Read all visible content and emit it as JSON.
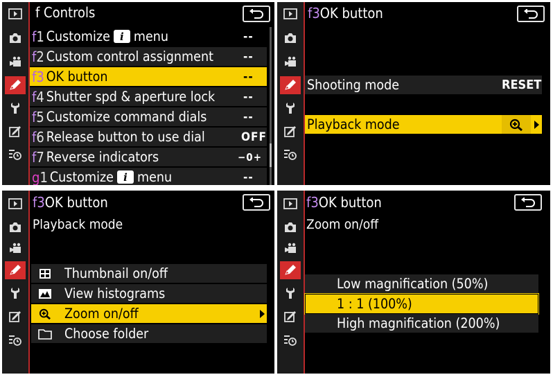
{
  "sidebar_icons": [
    "playback-icon",
    "camera-icon",
    "movie-icon",
    "pencil-icon",
    "wrench-icon",
    "retouch-icon",
    "recent-settings-icon"
  ],
  "panel1": {
    "title": "f Controls",
    "items": [
      {
        "code_letter": "f",
        "code_num": "1",
        "label_pre": "Customize",
        "badge": "i",
        "label_post": "menu",
        "value": "--"
      },
      {
        "code_letter": "f",
        "code_num": "2",
        "label": "Custom control assignment",
        "value": "--"
      },
      {
        "code_letter": "f",
        "code_num": "3",
        "label": "OK button",
        "value": "--"
      },
      {
        "code_letter": "f",
        "code_num": "4",
        "label": "Shutter spd & aperture lock",
        "value": "--"
      },
      {
        "code_letter": "f",
        "code_num": "5",
        "label": "Customize command dials",
        "value": "--"
      },
      {
        "code_letter": "f",
        "code_num": "6",
        "label": "Release button to use dial",
        "value": "OFF"
      },
      {
        "code_letter": "f",
        "code_num": "7",
        "label": "Reverse indicators",
        "value": "−0+"
      },
      {
        "code_letter": "g",
        "code_num": "1",
        "label_pre": "Customize",
        "badge": "i",
        "label_post": "menu",
        "value": "--"
      }
    ]
  },
  "panel2": {
    "code_letter": "f",
    "code_num": "3",
    "title": "OK button",
    "rows": [
      {
        "label": "Shooting mode",
        "value": "RESET"
      },
      {
        "label": "Playback mode",
        "icon": "zoom-icon"
      }
    ]
  },
  "panel3": {
    "code_letter": "f",
    "code_num": "3",
    "title": "OK button",
    "subtitle": "Playback mode",
    "options": [
      {
        "label": "Thumbnail on/off",
        "icon": "thumbnail-icon"
      },
      {
        "label": "View histograms",
        "icon": "histogram-icon"
      },
      {
        "label": "Zoom on/off",
        "icon": "zoom-icon"
      },
      {
        "label": "Choose folder",
        "icon": "folder-icon"
      }
    ]
  },
  "panel4": {
    "code_letter": "f",
    "code_num": "3",
    "title": "OK button",
    "subtitle": "Zoom on/off",
    "options": [
      {
        "label": "Low magnification (50%)"
      },
      {
        "label": "1 : 1 (100%)"
      },
      {
        "label": "High magnification (200%)"
      }
    ]
  },
  "colors": {
    "highlight": "#f7cf00",
    "sidebar_active": "#d42d2d",
    "code_letter": "#c58cf0",
    "code_g": "#e040c8"
  }
}
